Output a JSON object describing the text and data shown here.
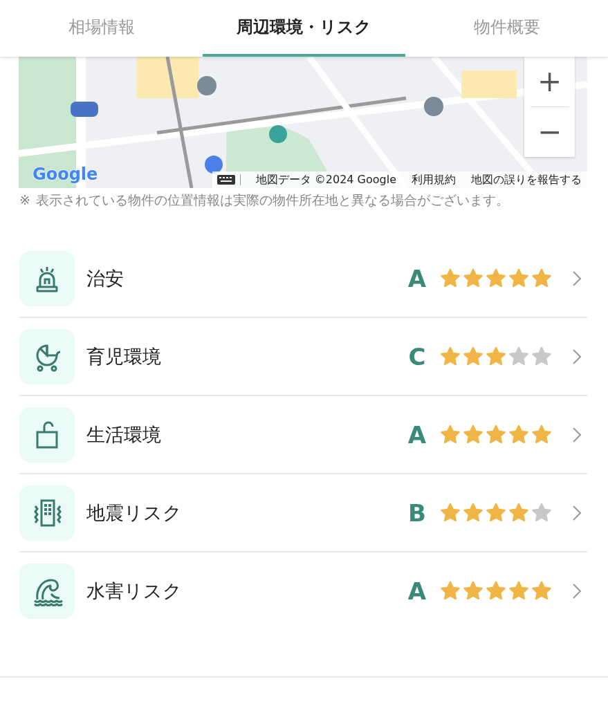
{
  "tabs": [
    {
      "label": "相場情報",
      "selected": false
    },
    {
      "label": "周辺環境・リスク",
      "selected": true
    },
    {
      "label": "物件概要",
      "selected": false
    }
  ],
  "map": {
    "kind": "picture",
    "zoom_in": "+",
    "zoom_out": "−",
    "logo": "Google",
    "attribution": [
      "地図データ ©2024 Google",
      "利用規約",
      "地図の誤りを報告する"
    ]
  },
  "note": {
    "mark": "※",
    "text": "表示されている物件の位置情報は実際の物件所在地と異なる場合がございます。"
  },
  "ratings": [
    {
      "label": "治安",
      "grade": "A",
      "stars": 5
    },
    {
      "label": "育児環境",
      "grade": "C",
      "stars": 3
    },
    {
      "label": "生活環境",
      "grade": "A",
      "stars": 5
    },
    {
      "label": "地震リスク",
      "grade": "B",
      "stars": 4
    },
    {
      "label": "水害リスク",
      "grade": "A",
      "stars": 5
    }
  ]
}
